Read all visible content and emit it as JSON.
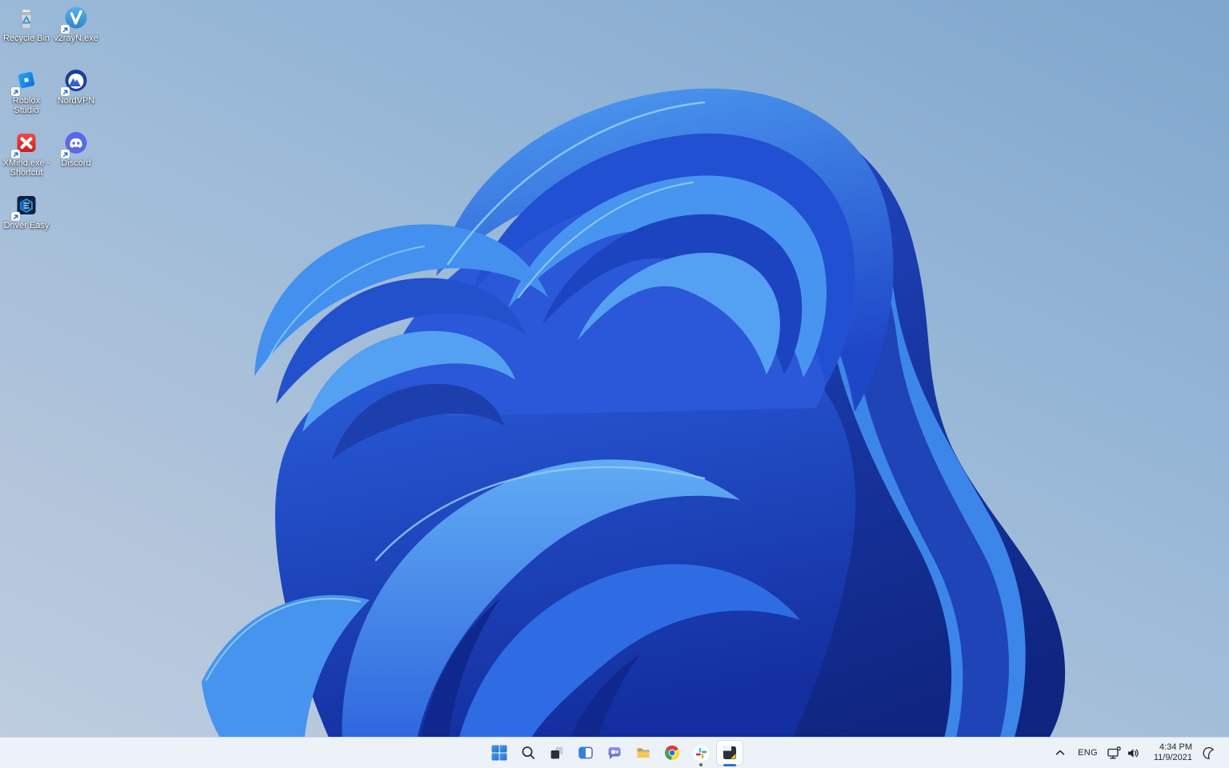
{
  "wallpaper": {
    "name": "windows-11-bloom",
    "bloom_blue_light": "#54a0f2",
    "bloom_blue_mid": "#2a5fe0",
    "bloom_blue_dark": "#132e9e",
    "background_blue": "#9cbad8"
  },
  "desktop": {
    "icons": [
      {
        "label": "Recycle Bin",
        "icon": "recycle-bin-icon",
        "shortcut": false
      },
      {
        "label": "v2rayN.exe",
        "icon": "v2rayn-icon",
        "shortcut": true
      },
      {
        "label": "Roblox Studio",
        "icon": "roblox-studio-icon",
        "shortcut": true
      },
      {
        "label": "NordVPN",
        "icon": "nordvpn-icon",
        "shortcut": true
      },
      {
        "label": "XMind.exe - Shortcut",
        "icon": "xmind-icon",
        "shortcut": true
      },
      {
        "label": "Discord",
        "icon": "discord-icon",
        "shortcut": true
      },
      {
        "label": "Driver Easy",
        "icon": "driver-easy-icon",
        "shortcut": true
      }
    ]
  },
  "taskbar": {
    "buttons": [
      {
        "name": "start",
        "icon": "windows-start-icon"
      },
      {
        "name": "search",
        "icon": "search-icon"
      },
      {
        "name": "task-view",
        "icon": "task-view-icon"
      },
      {
        "name": "widgets",
        "icon": "widgets-icon"
      },
      {
        "name": "chat",
        "icon": "teams-chat-icon"
      },
      {
        "name": "file-explorer",
        "icon": "file-explorer-icon"
      },
      {
        "name": "chrome",
        "icon": "chrome-icon"
      },
      {
        "name": "slack",
        "icon": "slack-icon",
        "running": true
      },
      {
        "name": "screenshot-app",
        "icon": "screenshot-app-icon",
        "active": true
      }
    ],
    "tray": {
      "language": "ENG",
      "time": "4:34 PM",
      "date": "11/9/2021",
      "icons": [
        "hidden-icons-chevron",
        "network-ethernet",
        "volume",
        "focus-assist-moon"
      ]
    },
    "colors": {
      "taskbar_bg": "#edf2f9",
      "accent_underline": "#2b74d0",
      "tray_text": "#1c242e"
    }
  }
}
